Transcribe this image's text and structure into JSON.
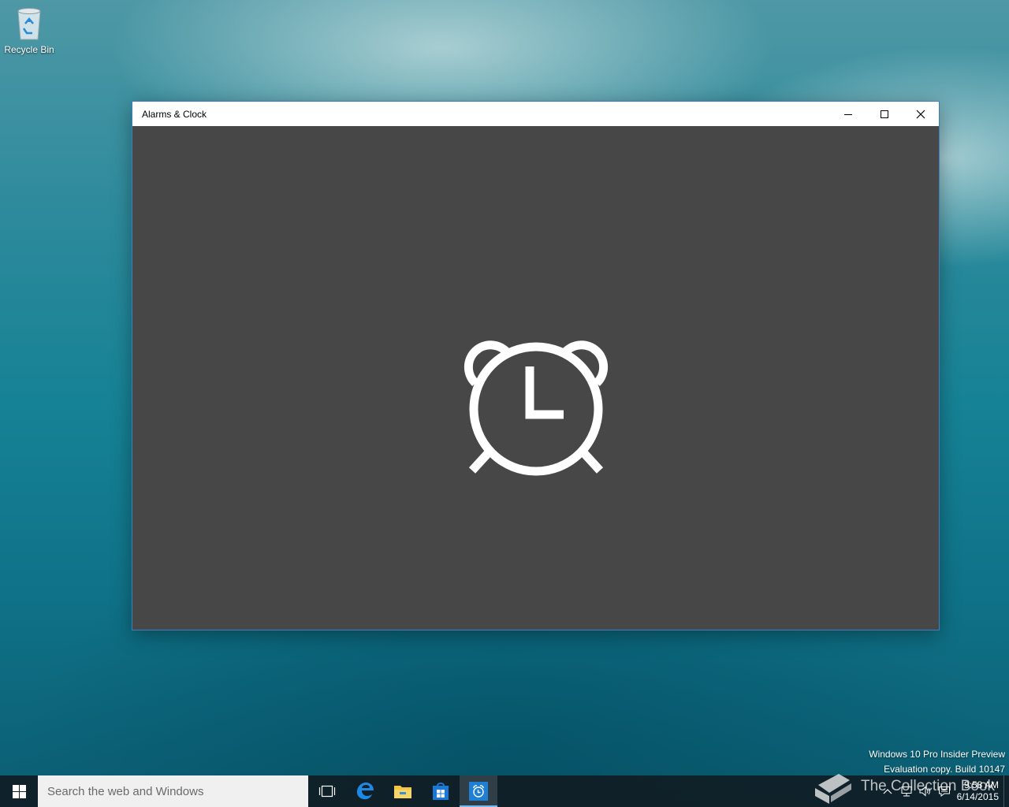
{
  "desktop": {
    "recycle_bin_label": "Recycle Bin",
    "watermark": {
      "line1": "Windows 10 Pro Insider Preview",
      "line2": "Evaluation copy. Build 10147"
    }
  },
  "window": {
    "title": "Alarms & Clock",
    "background_color": "#474747",
    "splash_icon": "alarm-clock-icon"
  },
  "taskbar": {
    "search_placeholder": "Search the web and Windows",
    "pinned": [
      {
        "name": "task-view-icon"
      },
      {
        "name": "edge-icon"
      },
      {
        "name": "file-explorer-icon"
      },
      {
        "name": "store-icon"
      },
      {
        "name": "alarms-clock-icon",
        "active": true
      }
    ],
    "clock": {
      "time": "9:58 AM",
      "date": "6/14/2015"
    },
    "accent_color": "#76b9ed"
  },
  "overlay": {
    "brand_text": "The Collection Book"
  }
}
